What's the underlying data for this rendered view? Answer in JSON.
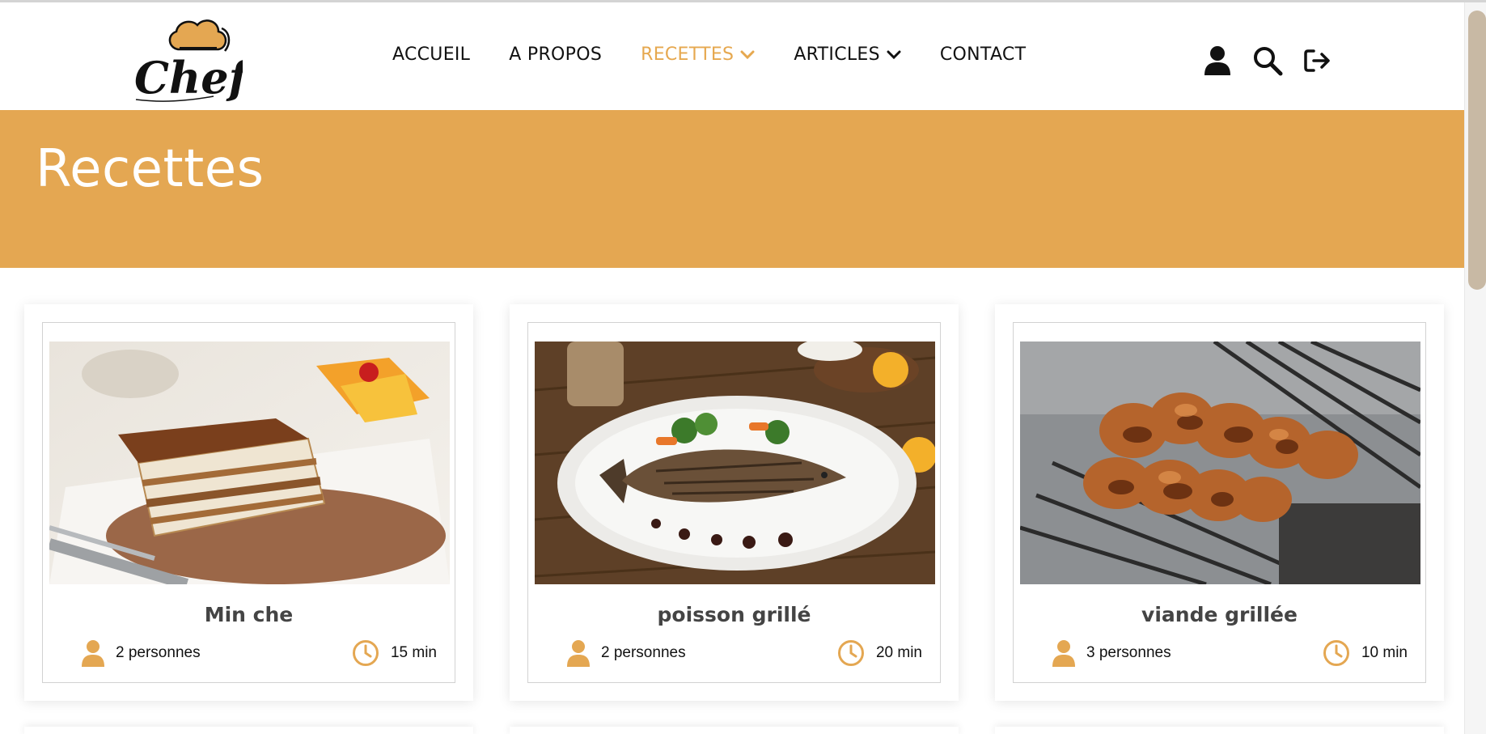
{
  "header": {
    "logo_text": "Chef",
    "nav": [
      {
        "label": "ACCUEIL",
        "has_dropdown": false,
        "active": false
      },
      {
        "label": "A PROPOS",
        "has_dropdown": false,
        "active": false
      },
      {
        "label": "RECETTES",
        "has_dropdown": true,
        "active": true
      },
      {
        "label": "ARTICLES",
        "has_dropdown": true,
        "active": false
      },
      {
        "label": "CONTACT",
        "has_dropdown": false,
        "active": false
      }
    ],
    "icons": [
      "user-icon",
      "search-icon",
      "logout-icon"
    ]
  },
  "banner": {
    "title": "Recettes"
  },
  "recipes": [
    {
      "title": "Min che",
      "people": "2 personnes",
      "time": "15 min",
      "image": "tiramisu dessert photo"
    },
    {
      "title": "poisson grillé",
      "people": "2 personnes",
      "time": "20 min",
      "image": "grilled fish plate photo"
    },
    {
      "title": "viande grillée",
      "people": "3 personnes",
      "time": "10 min",
      "image": "grilled meat skewers photo"
    }
  ],
  "colors": {
    "accent": "#e4a752",
    "nav_active": "#e6a84f",
    "text": "#111111",
    "banner_text": "#ffffff"
  }
}
